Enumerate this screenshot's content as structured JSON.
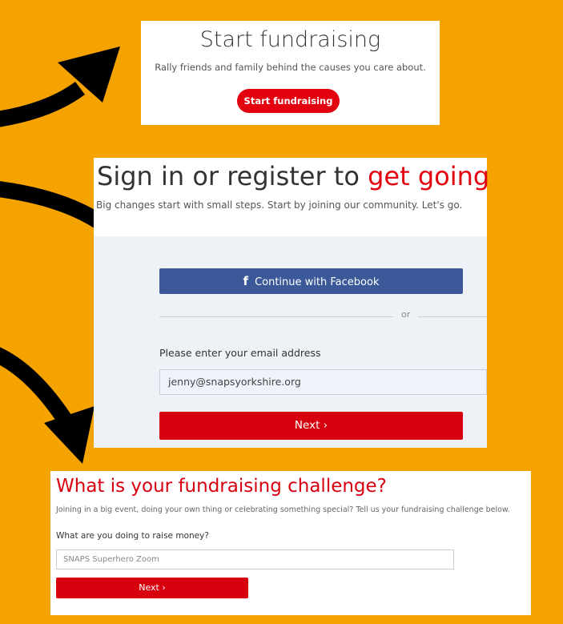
{
  "panel1": {
    "title": "Start fundraising",
    "subtitle": "Rally friends and family behind the causes you care about.",
    "button_label": "Start fundraising"
  },
  "panel2": {
    "title_prefix": "Sign in or register to ",
    "title_accent": "get going",
    "subtitle": "Big changes start with small steps. Start by joining our community. Let's go.",
    "facebook_icon": "f",
    "facebook_label": "Continue with Facebook",
    "divider_text": "or",
    "email_label": "Please enter your email address",
    "email_value": "jenny@snapsyorkshire.org",
    "next_label": "Next ›"
  },
  "panel3": {
    "title": "What is your fundraising challenge?",
    "subtitle": "Joining in a big event, doing your own thing or celebrating something special? Tell us your fundraising challenge below.",
    "question_label": "What are you doing to raise money?",
    "answer_value": "SNAPS Superhero Zoom",
    "next_label": "Next ›"
  },
  "colors": {
    "background": "#f5a300",
    "brand_red": "#e3000f",
    "facebook_blue": "#3b5998",
    "arrow": "#000000"
  }
}
